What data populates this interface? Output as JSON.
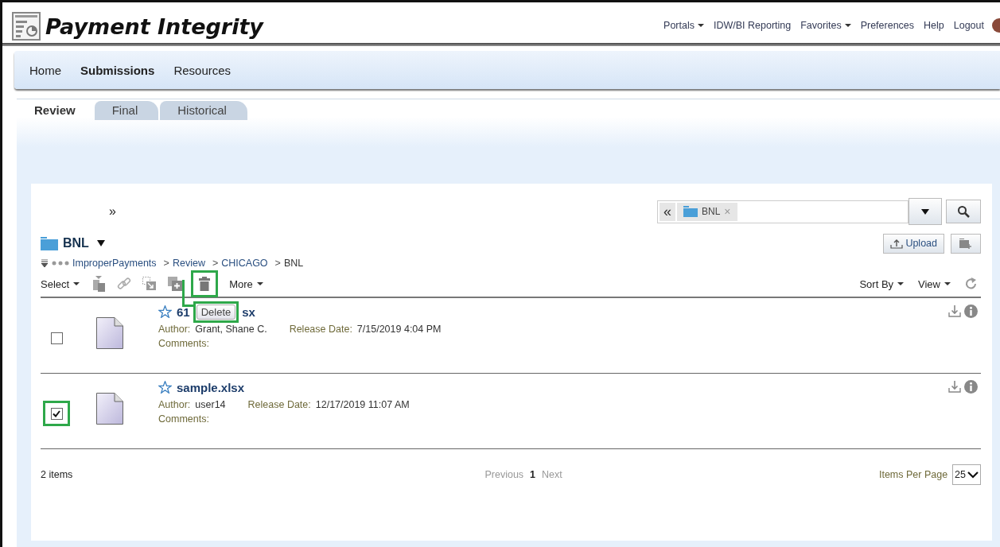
{
  "header": {
    "title": "Payment Integrity",
    "links": [
      {
        "label": "Portals",
        "dropdown": true
      },
      {
        "label": "IDW/BI Reporting",
        "dropdown": false
      },
      {
        "label": "Favorites",
        "dropdown": true
      },
      {
        "label": "Preferences",
        "dropdown": false
      },
      {
        "label": "Help",
        "dropdown": false
      },
      {
        "label": "Logout",
        "dropdown": false
      }
    ]
  },
  "nav": [
    {
      "label": "Home",
      "selected": false
    },
    {
      "label": "Submissions",
      "selected": true
    },
    {
      "label": "Resources",
      "selected": false
    }
  ],
  "tabs": [
    {
      "label": "Review",
      "selected": true
    },
    {
      "label": "Final",
      "selected": false
    },
    {
      "label": "Historical",
      "selected": false
    }
  ],
  "panel": {
    "expand": "»",
    "search": {
      "collapse": "«",
      "chip": "BNL",
      "chip_close": "×"
    },
    "folder": "BNL",
    "upload": "Upload",
    "breadcrumb": {
      "separator": ">",
      "items": [
        "ImproperPayments",
        "Review",
        "CHICAGO",
        "BNL"
      ]
    },
    "toolbar": {
      "select": "Select",
      "more": "More",
      "sort": "Sort By",
      "view": "View",
      "icons": [
        {
          "kind": "versions",
          "highlighted": false
        },
        {
          "kind": "link",
          "highlighted": false
        },
        {
          "kind": "move",
          "highlighted": false
        },
        {
          "kind": "copy",
          "highlighted": false
        },
        {
          "kind": "delete",
          "highlighted": true
        }
      ]
    },
    "tooltip": {
      "text": "Delete",
      "highlighted": true
    },
    "files": [
      {
        "name_parts": [
          "61",
          "sx"
        ],
        "author_label": "Author:",
        "author": "Grant, Shane C.",
        "date_label": "Release Date:",
        "date": "7/15/2019 4:04 PM",
        "comments_label": "Comments:",
        "checked": false,
        "highlighted": false
      },
      {
        "name_parts": [
          "sample.xlsx"
        ],
        "author_label": "Author:",
        "author": "user14",
        "date_label": "Release Date:",
        "date": "12/17/2019 11:07 AM",
        "comments_label": "Comments:",
        "checked": true,
        "highlighted": true
      }
    ],
    "footer": {
      "count": "2 items",
      "previous": "Previous",
      "page": "1",
      "next": "Next",
      "per_page_label": "Items Per Page",
      "per_page": "25"
    }
  }
}
